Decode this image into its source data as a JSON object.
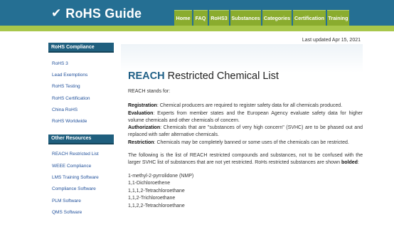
{
  "header": {
    "logo_check": "✔",
    "logo_text": "RoHS Guide",
    "nav": [
      "Home",
      "FAQ",
      "RoHS3",
      "Substances",
      "Categories",
      "Certification",
      "Training"
    ]
  },
  "last_updated": "Last updated  Apr 15, 2021",
  "sidebar": {
    "rohs_compliance": {
      "heading": "RoHS Compliance",
      "items": [
        "RoHS 3",
        "Lead Exemptions",
        "RoHS Testing",
        "RoHS Certification",
        "China RoHS",
        "RoHS Worldwide"
      ]
    },
    "other_resources": {
      "heading": "Other Resources",
      "items": [
        "REACH Restricted List",
        "WEEE Compliance",
        "LMS Training Software",
        "Compliance Software",
        "PLM Software",
        "QMS Software"
      ]
    }
  },
  "main": {
    "title_strong": "REACH",
    "title_rest": " Restricted Chemical List",
    "stands_for": "REACH stands for:",
    "definitions": [
      {
        "term": "Registration",
        "text": ": Chemical producers are required to register safety data for all chemicals produced."
      },
      {
        "term": "Evaluation",
        "text": ": Experts from member states and the European Agency evaluate safety data for higher volume chemicals and other chemicals of concern."
      },
      {
        "term": "Authorization",
        "text": ": Chemicals that are \"substances of very high concern\" (SVHC) are to be phased out and replaced with safer alternative chemicals."
      },
      {
        "term": "Restriction",
        "text": ": Chemicals may be completely banned or some uses of the chemicals can be restricted."
      }
    ],
    "following_text": "The following is the list of REACH restricted compounds and substances, not to be confused with the larger SVHC list of substances that are not yet restricted. RoHs restricted substances are shown ",
    "following_bold": "bolded",
    "following_end": ":",
    "chemicals": [
      "1-methyl-2-pyrrolidone (NMP)",
      "1,1-Dichloroethene",
      "1,1,1,2-Tetrachloroethane",
      "1,1,2-Trichloroethane",
      "1,1,2,2-Tetrachloroethane"
    ]
  }
}
